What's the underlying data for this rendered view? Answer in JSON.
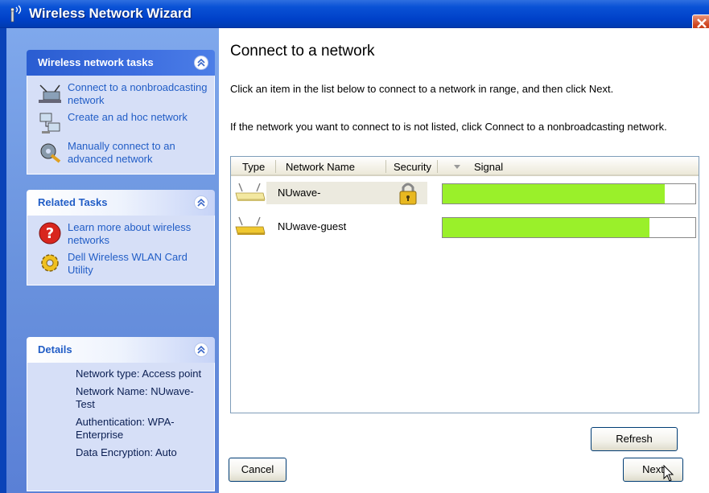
{
  "window": {
    "title": "Wireless Network Wizard"
  },
  "sidebar": {
    "tasks": {
      "title": "Wireless network tasks",
      "items": [
        {
          "label": "Connect to a nonbroadcasting network",
          "icon": "network-connect-icon"
        },
        {
          "label": "Create an ad hoc network",
          "icon": "ad-hoc-network-icon"
        },
        {
          "label": "Manually connect to an advanced network",
          "icon": "advanced-network-gear-icon"
        }
      ]
    },
    "related": {
      "title": "Related Tasks",
      "items": [
        {
          "label": "Learn more about wireless networks",
          "icon": "help-icon"
        },
        {
          "label": "Dell Wireless WLAN Card Utility",
          "icon": "gear-icon"
        }
      ]
    },
    "details": {
      "title": "Details",
      "lines": [
        "Network type: Access point",
        "Network Name: NUwave-Test",
        "Authentication: WPA-Enterprise",
        "Data Encryption: Auto"
      ]
    }
  },
  "main": {
    "heading": "Connect to a network",
    "instruction1": "Click an item in the list below to connect to a network in range, and then click Next.",
    "instruction2": "If the network you want to connect to is not listed, click Connect to a nonbroadcasting network.",
    "columns": [
      "Type",
      "Network Name",
      "Security",
      "Signal"
    ],
    "networks": [
      {
        "name": "NUwave-",
        "secured": true,
        "signal": 0.88,
        "selected": true
      },
      {
        "name": "NUwave-guest",
        "secured": false,
        "signal": 0.82,
        "selected": false
      }
    ],
    "refresh_label": "Refresh",
    "cancel_label": "Cancel",
    "next_label": "Next"
  },
  "colors": {
    "signal": "#9af02a",
    "titlebar": "#0041c8",
    "link": "#215dc6"
  }
}
